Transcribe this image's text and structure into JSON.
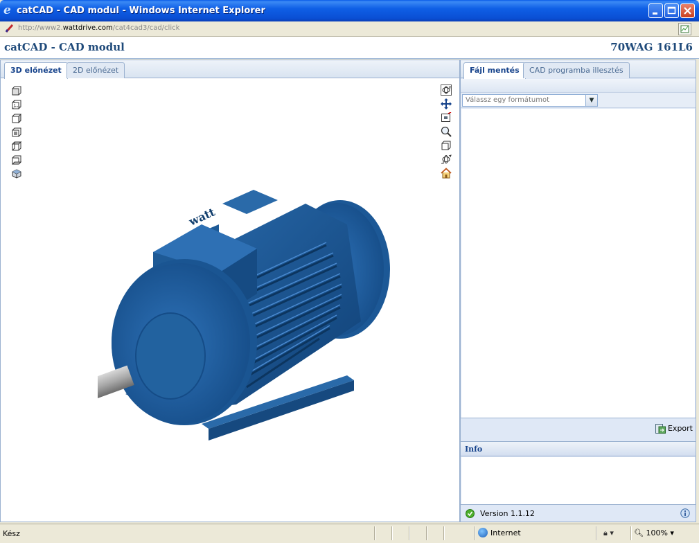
{
  "window": {
    "title": "catCAD - CAD modul - Windows Internet Explorer"
  },
  "address": {
    "prefix": "http://www2.",
    "host": "wattdrive.com",
    "path": "/cat4cad3/cad/click"
  },
  "header": {
    "app_title": "catCAD - CAD modul",
    "model": "70WAG 161L6"
  },
  "left_tabs": [
    {
      "label": "3D előnézet",
      "active": true
    },
    {
      "label": "2D előnézet",
      "active": false
    }
  ],
  "viewer": {
    "left_tools": [
      "view-front-icon",
      "view-back-icon",
      "view-left-icon",
      "view-right-icon",
      "view-top-icon",
      "view-bottom-icon",
      "view-iso-icon"
    ],
    "right_tools": [
      "rotate-icon",
      "pan-icon",
      "zoom-window-icon",
      "zoom-icon",
      "fit-view-icon",
      "reset-rotate-icon",
      "home-icon"
    ],
    "model_brand": "watt",
    "model_color": "#1e5a96"
  },
  "right_tabs": [
    {
      "label": "Fájl mentés",
      "active": true
    },
    {
      "label": "CAD programba illesztés",
      "active": false
    }
  ],
  "format_select": {
    "placeholder": "Válassz egy formátumot"
  },
  "export": {
    "label": "Export"
  },
  "info": {
    "title": "Info"
  },
  "version": {
    "text": "Version 1.1.12"
  },
  "statusbar": {
    "status": "Kész",
    "zone": "Internet",
    "zoom": "100%"
  },
  "colors": {
    "accent": "#15428b",
    "panel": "#dfe8f6",
    "border": "#99b0cf",
    "titlebar": "#0a4fd4"
  }
}
